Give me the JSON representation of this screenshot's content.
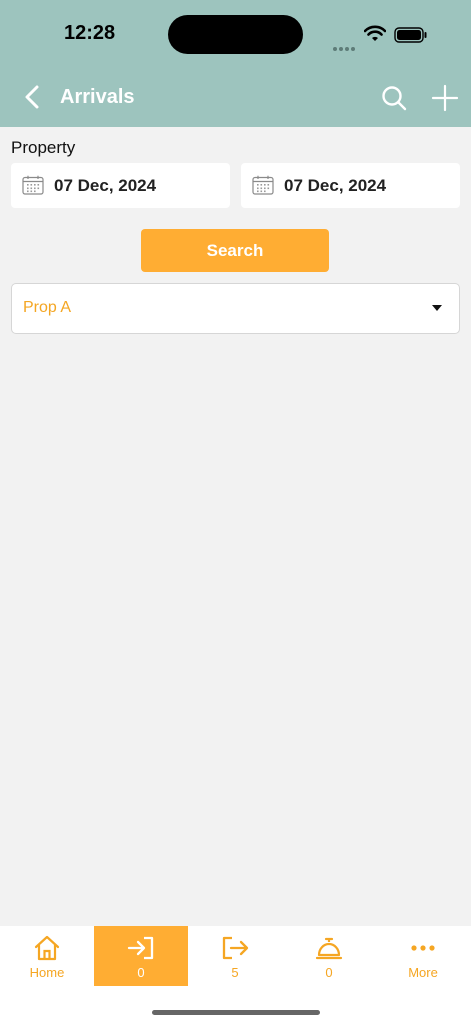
{
  "status_bar": {
    "time": "12:28"
  },
  "nav": {
    "title": "Arrivals"
  },
  "form": {
    "property_label": "Property",
    "from_date": "07 Dec, 2024",
    "to_date": "07 Dec, 2024",
    "search_label": "Search",
    "property_value": "Prop A"
  },
  "tabs": [
    {
      "label": "Home",
      "icon": "home-icon"
    },
    {
      "label": "0",
      "icon": "arrival-icon",
      "active": true
    },
    {
      "label": "5",
      "icon": "departure-icon"
    },
    {
      "label": "0",
      "icon": "bell-icon"
    },
    {
      "label": "More",
      "icon": "more-icon"
    }
  ],
  "colors": {
    "header": "#9dc4be",
    "accent": "#ffad33",
    "background": "#f2f2f2"
  }
}
